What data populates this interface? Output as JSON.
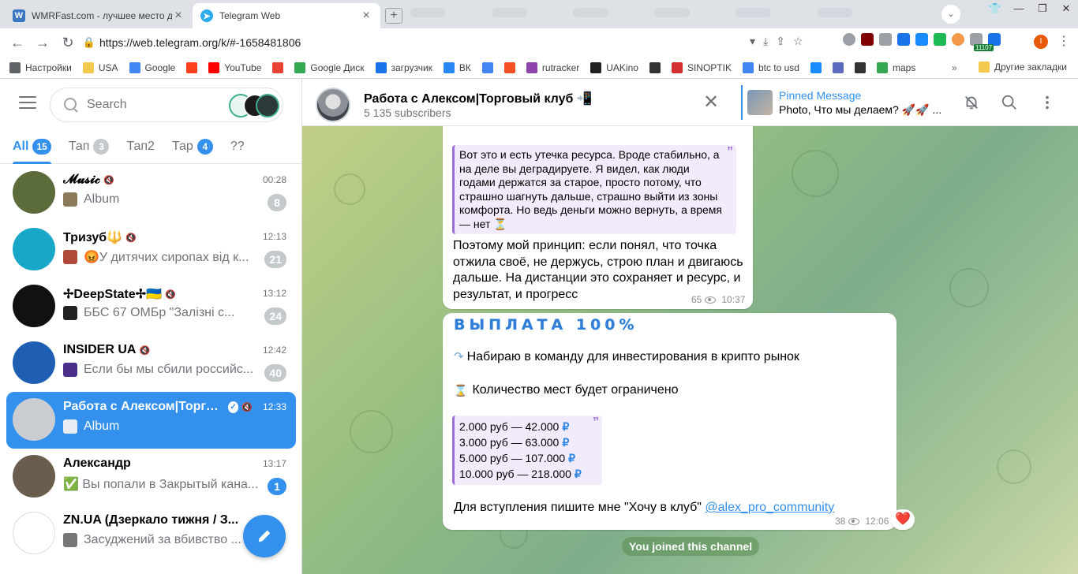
{
  "browser": {
    "tabs": [
      {
        "title": "WMRFast.com - лучшее место дл",
        "icon": "w-favicon-icon",
        "active": false
      },
      {
        "title": "Telegram Web",
        "icon": "telegram-favicon-icon",
        "active": true
      }
    ],
    "url": "https://web.telegram.org/k/#-1658481806",
    "extension_badge": "11107",
    "profile_initial": "I",
    "bookmarks": [
      {
        "label": "Настройки",
        "icon": "gear-icon"
      },
      {
        "label": "USA",
        "icon": "folder-icon"
      },
      {
        "label": "Google",
        "icon": "google-icon"
      },
      {
        "label": "",
        "icon": "yandex-icon"
      },
      {
        "label": "YouTube",
        "icon": "youtube-icon"
      },
      {
        "label": "",
        "icon": "gmail-icon"
      },
      {
        "label": "Google Диск",
        "icon": "google-drive-icon"
      },
      {
        "label": "загрузчик",
        "icon": "infinity-icon"
      },
      {
        "label": "ВК",
        "icon": "vk-icon"
      },
      {
        "label": "",
        "icon": "translate-icon"
      },
      {
        "label": "",
        "icon": "f-icon"
      },
      {
        "label": "rutracker",
        "icon": "rutracker-icon"
      },
      {
        "label": "UAKino",
        "icon": "uakino-icon"
      },
      {
        "label": "",
        "icon": "chess-icon"
      },
      {
        "label": "SINOPTIK",
        "icon": "thermometer-icon"
      },
      {
        "label": "btc to usd",
        "icon": "google-icon"
      },
      {
        "label": "",
        "icon": "p-icon"
      },
      {
        "label": "",
        "icon": "arrow-icon"
      },
      {
        "label": "",
        "icon": "bc-icon"
      },
      {
        "label": "maps",
        "icon": "maps-icon"
      }
    ],
    "bookmarks_more": "»",
    "other_bookmarks": "Другие закладки"
  },
  "sidebar": {
    "search_placeholder": "Search",
    "folders": [
      {
        "label": "All",
        "badge": "15",
        "active": true
      },
      {
        "label": "Тап",
        "badge": "3",
        "active": false
      },
      {
        "label": "Тап2",
        "badge": "",
        "active": false
      },
      {
        "label": "Тар",
        "badge": "4",
        "active": false,
        "blue": true
      },
      {
        "label": "??",
        "badge": "",
        "active": false
      }
    ],
    "chats": [
      {
        "name": "𝓜𝓾𝓼𝓲𝓬",
        "muted": true,
        "time": "00:28",
        "preview": "Album",
        "unread": "8",
        "selected": false,
        "ava": "#5b6b3a",
        "thumb": "#8a7a5a"
      },
      {
        "name": "Тризуб🔱",
        "muted": true,
        "time": "12:13",
        "preview": "😡У дитячих сиропах від к...",
        "unread": "21",
        "selected": false,
        "ava": "#19a7c8",
        "thumb": "#b04a3a"
      },
      {
        "name": "✢DeepState✢🇺🇦",
        "muted": true,
        "time": "13:12",
        "preview": "ББС 67 ОМБр \"Залізні с...",
        "unread": "24",
        "selected": false,
        "ava": "#111111",
        "thumb": "#222222"
      },
      {
        "name": "INSIDER UA",
        "muted": true,
        "time": "12:42",
        "preview": "Если бы мы сбили российс...",
        "unread": "40",
        "selected": false,
        "ava": "#1e5fb3",
        "thumb": "#4a2f8a"
      },
      {
        "name": "Работа с Алексом|Торговы...",
        "muted": true,
        "verified": true,
        "time": "12:33",
        "preview": "Album",
        "unread": "",
        "selected": true,
        "ava": "#c9cdd1",
        "thumb": "#e8edf3"
      },
      {
        "name": "Александр",
        "muted": false,
        "time": "13:17",
        "preview": "✅ Вы попали в Закрытый кана...",
        "unread": "1",
        "unread_blue": true,
        "selected": false,
        "ava": "#6b5d4d",
        "thumb": ""
      },
      {
        "name": "ZN.UA (Дзеркало тижня / З...",
        "muted": false,
        "time": "",
        "preview": "Засуджений за вбивство ...",
        "unread": "",
        "selected": false,
        "ava": "#ffffff",
        "thumb": "#777777"
      }
    ]
  },
  "chat": {
    "title": "Работа с Алексом|Торговый клуб 📲",
    "subscribers": "5 135 subscribers",
    "pinned_label": "Pinned Message",
    "pinned_text": "Photo, Что мы делаем? 🚀🚀 ...",
    "messages": [
      {
        "quote": "Вот это и есть утечка ресурса. Вроде стабильно, а на деле вы деградируете. Я видел, как люди годами держатся за старое, просто потому, что страшно шагнуть дальше, страшно выйти из зоны комфорта. Но ведь деньги можно вернуть, а время — нет ⏳",
        "text": "Поэтому мой принцип: если понял, что точка отжила своё, не держусь, строю план и двигаюсь дальше. На дистанции это сохраняет и ресурс, и результат, и прогресс",
        "views": "65",
        "time": "10:37"
      },
      {
        "title": "ВЫПЛАТА 100%",
        "line1": "Набираю в команду для инвестирования в крипто рынок",
        "line2": "Количество мест будет ограничено",
        "payouts": [
          "2.000 руб — 42.000",
          "3.000 руб — 63.000",
          "5.000 руб — 107.000",
          "10.000 руб — 218.000"
        ],
        "ruble": "₽",
        "cta": "Для вступления пишите мне \"Хочу в клуб\" ",
        "cta_link": "@alex_pro_community",
        "views": "38",
        "time": "12:06",
        "reaction": "❤️"
      }
    ],
    "service": "You joined this channel"
  },
  "colors": {
    "accent": "#3390ec",
    "quote_border": "#9a6dd7"
  }
}
